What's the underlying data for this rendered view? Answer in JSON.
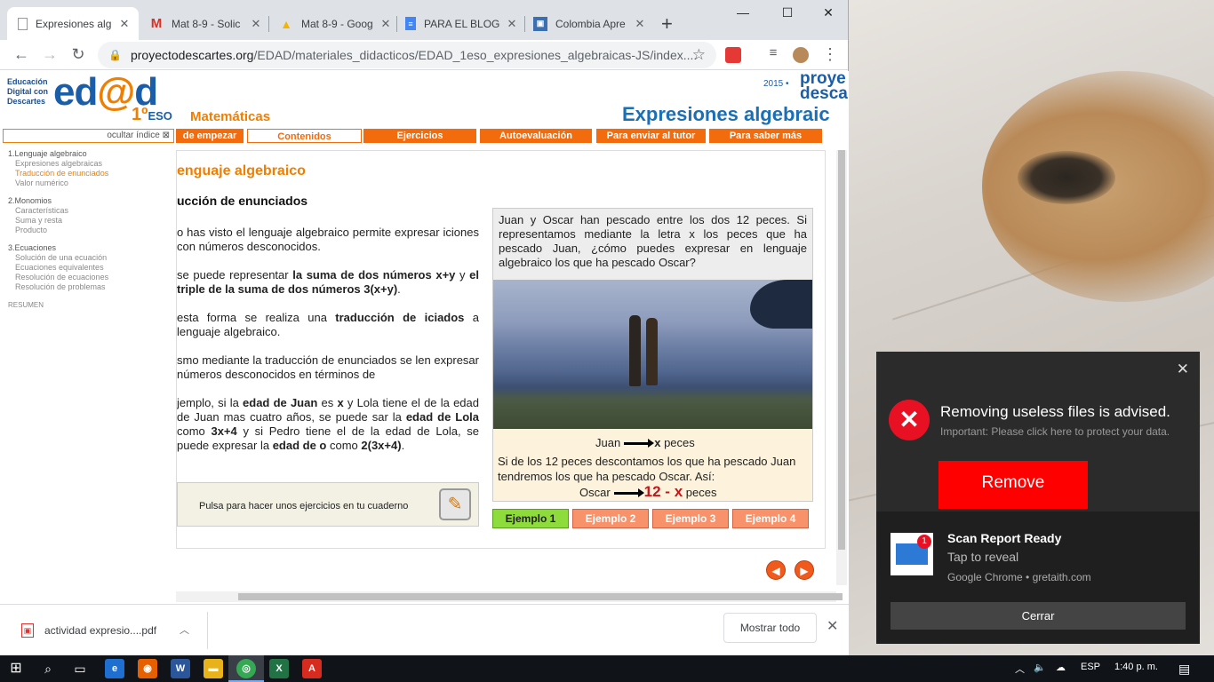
{
  "tabs": [
    {
      "title": "Expresiones alg",
      "icon": "document-icon",
      "active": true
    },
    {
      "title": "Mat 8-9 - Solic",
      "icon": "gmail-icon",
      "active": false
    },
    {
      "title": "Mat 8-9 - Goog",
      "icon": "drive-icon",
      "active": false
    },
    {
      "title": "PARA EL BLOG",
      "icon": "docs-icon",
      "active": false
    },
    {
      "title": "Colombia Apre",
      "icon": "site-icon",
      "active": false
    }
  ],
  "window": {
    "minimize": "—",
    "maximize": "☐",
    "close": "✕",
    "newtab": "+"
  },
  "address": {
    "domain": "proyectodescartes.org",
    "path": "/EDAD/materiales_didacticos/EDAD_1eso_expresiones_algebraicas-JS/index...."
  },
  "logo": {
    "small_lines": [
      "Educación",
      "Digital con",
      "Descartes"
    ],
    "edad_pre": "ed",
    "edad_at": "@",
    "edad_post": "d",
    "grade": "1º",
    "grade_suffix": "ESO",
    "year": "2015 •",
    "proyecto_line1": "proye",
    "proyecto_line2": "descar"
  },
  "subject": "Matemáticas",
  "main_title": "Expresiones algebraic",
  "menu": {
    "hide_index": "ocultar índice ⊠",
    "items": [
      "de empezar",
      "Contenidos",
      "Ejercicios",
      "Autoevaluación",
      "Para enviar al tutor",
      "Para saber más"
    ]
  },
  "sidebar": {
    "sections": [
      {
        "title": "1.Lenguaje algebraico",
        "items": [
          {
            "label": "Expresiones algebraicas",
            "current": false
          },
          {
            "label": "Traducción de enunciados",
            "current": true
          },
          {
            "label": "Valor numérico",
            "current": false
          }
        ]
      },
      {
        "title": "2.Monomios",
        "items": [
          {
            "label": "Características",
            "current": false
          },
          {
            "label": "Suma y resta",
            "current": false
          },
          {
            "label": "Producto",
            "current": false
          }
        ]
      },
      {
        "title": "3.Ecuaciones",
        "items": [
          {
            "label": "Solución de una ecuación",
            "current": false
          },
          {
            "label": "Ecuaciones equivalentes",
            "current": false
          },
          {
            "label": "Resolución de ecuaciones",
            "current": false
          },
          {
            "label": "Resolución de problemas",
            "current": false
          }
        ]
      }
    ],
    "summary": "RESUMEN"
  },
  "content": {
    "heading": "enguaje algebraico",
    "subheading": "ucción de enunciados",
    "para1": "o has visto el lenguaje algebraico permite expresar iciones con números desconocidos.",
    "para2_a": "se puede representar ",
    "para2_b": "la suma de dos números x+y",
    "para2_c": " y ",
    "para2_d": "el triple de la suma de dos números 3(x+y)",
    "para2_e": ".",
    "para3_a": "esta forma se realiza una ",
    "para3_b": "traducción de iciados",
    "para3_c": " a lenguaje algebraico.",
    "para4": "smo mediante la traducción de enunciados se len expresar números desconocidos en términos de",
    "para5_a": "jemplo, si la ",
    "para5_b": "edad de Juan",
    "para5_c": " es ",
    "para5_d": "x",
    "para5_e": " y Lola tiene el de la edad de Juan mas cuatro años, se puede sar la ",
    "para5_f": "edad de Lola",
    "para5_g": " como ",
    "para5_h": "3x+4",
    "para5_i": " y si Pedro tiene el de la edad de Lola, se puede expresar la ",
    "para5_j": "edad de o",
    "para5_k": " como ",
    "para5_l": "2(3x+4)",
    "para5_m": ".",
    "exercise_button": "Pulsa para hacer unos ejercicios en tu cuaderno"
  },
  "example": {
    "question": "Juan y  Oscar han pescado  entre los dos 12 peces. Si representamos  mediante la letra  x  los peces  que  ha pescado Juan, ¿cómo puedes expresar en lenguaje algebraico los que ha pescado Oscar?",
    "juan_label": "Juan",
    "juan_value": "x",
    "juan_unit": "peces",
    "description": "Si de  los 12 peces descontamos  los  que  ha pescado Juan tendremos los que ha pescado Oscar. Así:",
    "oscar_label": "Oscar",
    "oscar_value": "12 - x",
    "oscar_unit": "peces",
    "tabs": [
      "Ejemplo 1",
      "Ejemplo 2",
      "Ejemplo 3",
      "Ejemplo 4"
    ]
  },
  "download": {
    "file": "actividad expresio....pdf",
    "show_all": "Mostrar todo"
  },
  "notification1": {
    "title": "Removing useless files is advised.",
    "subtitle": "Important: Please click here to protect your data.",
    "button": "Remove"
  },
  "notification2": {
    "title": "Scan Report Ready",
    "subtitle": "Tap to reveal",
    "source": "Google Chrome • gretaith.com",
    "badge": "1",
    "close": "Cerrar"
  },
  "taskbar": {
    "language": "ESP",
    "time": "1:40 p. m."
  }
}
